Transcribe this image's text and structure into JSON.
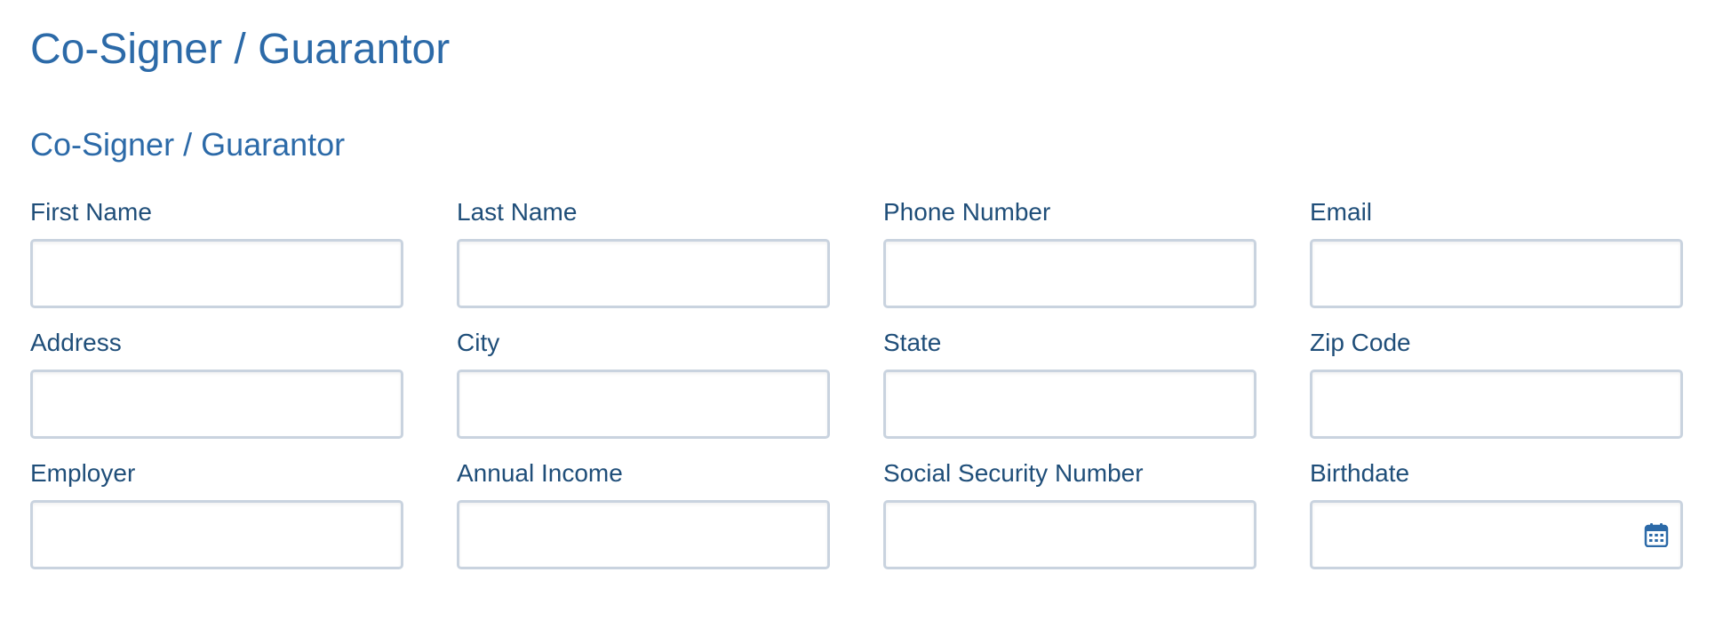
{
  "page": {
    "title": "Co-Signer / Guarantor"
  },
  "section": {
    "title": "Co-Signer / Guarantor"
  },
  "fields": {
    "first_name": {
      "label": "First Name",
      "value": "",
      "placeholder": ""
    },
    "last_name": {
      "label": "Last Name",
      "value": "",
      "placeholder": ""
    },
    "phone_number": {
      "label": "Phone Number",
      "value": "",
      "placeholder": ""
    },
    "email": {
      "label": "Email",
      "value": "",
      "placeholder": ""
    },
    "address": {
      "label": "Address",
      "value": "",
      "placeholder": ""
    },
    "city": {
      "label": "City",
      "value": "",
      "placeholder": ""
    },
    "state": {
      "label": "State",
      "value": "",
      "placeholder": ""
    },
    "zip_code": {
      "label": "Zip Code",
      "value": "",
      "placeholder": ""
    },
    "employer": {
      "label": "Employer",
      "value": "",
      "placeholder": ""
    },
    "annual_income": {
      "label": "Annual Income",
      "value": "",
      "placeholder": ""
    },
    "ssn": {
      "label": "Social Security Number",
      "value": "",
      "placeholder": ""
    },
    "birthdate": {
      "label": "Birthdate",
      "value": "",
      "placeholder": "",
      "icon": "calendar-icon"
    }
  },
  "colors": {
    "heading": "#2c6aa8",
    "label": "#1f4e79",
    "input_border": "#c9d3df"
  }
}
